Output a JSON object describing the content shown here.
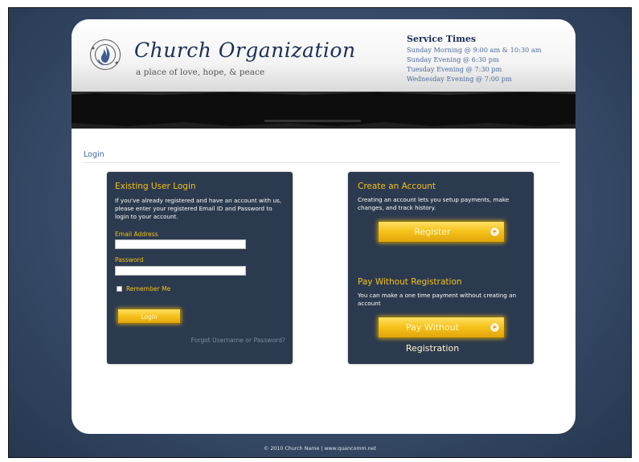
{
  "header": {
    "title": "Church Organization",
    "tagline": "a place of love, hope, & peace",
    "service_times": {
      "title": "Service Times",
      "items": [
        "Sunday Morning @ 9:00 am & 10:30 am",
        "Sunday Evening @ 6:30 pm",
        "Tuesday Evening @ 7:30 pm",
        "Wednesday Evening @ 7:00 pm"
      ]
    }
  },
  "breadcrumb": "Login",
  "existing": {
    "title": "Existing User Login",
    "description": "If you've already registered and have an account with us, please enter your registered Email ID and Password to login to your account.",
    "email_label": "Email Address",
    "email_value": "",
    "password_label": "Password",
    "password_value": "",
    "remember_label": "Remember Me",
    "login_label": "Login",
    "forgot_label": "Forgot Username or Password?"
  },
  "create": {
    "title": "Create an Account",
    "description": "Creating an account lets you setup payments, make changes, and track history.",
    "register_label": "Register"
  },
  "pay": {
    "title": "Pay Without Registration",
    "description": "You can make a one time payment without creating an account",
    "button_label": "Pay Without Registration"
  },
  "footer": "© 2010 Church Name | www.quancomm.net",
  "colors": {
    "accent": "#f4c21a",
    "panel": "#2c3a4f",
    "brand": "#1b2f55"
  }
}
